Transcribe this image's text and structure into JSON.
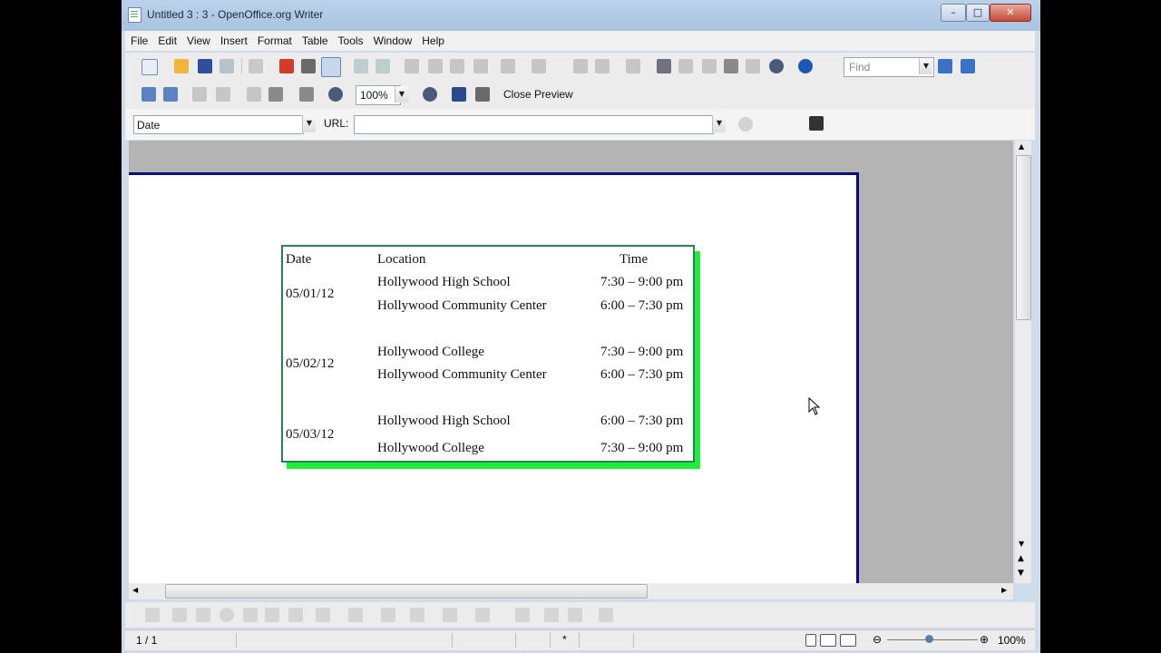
{
  "window": {
    "title": "Untitled 3 : 3 - OpenOffice.org Writer"
  },
  "menu": [
    "File",
    "Edit",
    "View",
    "Insert",
    "Format",
    "Table",
    "Tools",
    "Window",
    "Help"
  ],
  "toolbar": {
    "find_placeholder": "Find"
  },
  "preview_toolbar": {
    "zoom": "100%",
    "close_preview_label": "Close Preview"
  },
  "hyperlink_bar": {
    "name_value": "Date",
    "url_label": "URL:",
    "url_value": ""
  },
  "document": {
    "headers": {
      "date": "Date",
      "location": "Location",
      "time": "Time"
    },
    "groups": [
      {
        "date": "05/01/12",
        "rows": [
          {
            "location": "Hollywood High School",
            "time": "7:30 – 9:00 pm"
          },
          {
            "location": "Hollywood Community Center",
            "time": "6:00 – 7:30 pm"
          }
        ]
      },
      {
        "date": "05/02/12",
        "rows": [
          {
            "location": "Hollywood College",
            "time": "7:30 – 9:00 pm"
          },
          {
            "location": "Hollywood Community Center",
            "time": "6:00 – 7:30 pm"
          }
        ]
      },
      {
        "date": "05/03/12",
        "rows": [
          {
            "location": "Hollywood High School",
            "time": "6:00 – 7:30 pm"
          },
          {
            "location": "Hollywood College",
            "time": "7:30 – 9:00 pm"
          }
        ]
      }
    ]
  },
  "status": {
    "page": "1 / 1",
    "modified_marker": "*",
    "zoom": "100%"
  },
  "colors": {
    "frame_shadow": "#1ef03a",
    "page_border": "#0a0a7a"
  }
}
